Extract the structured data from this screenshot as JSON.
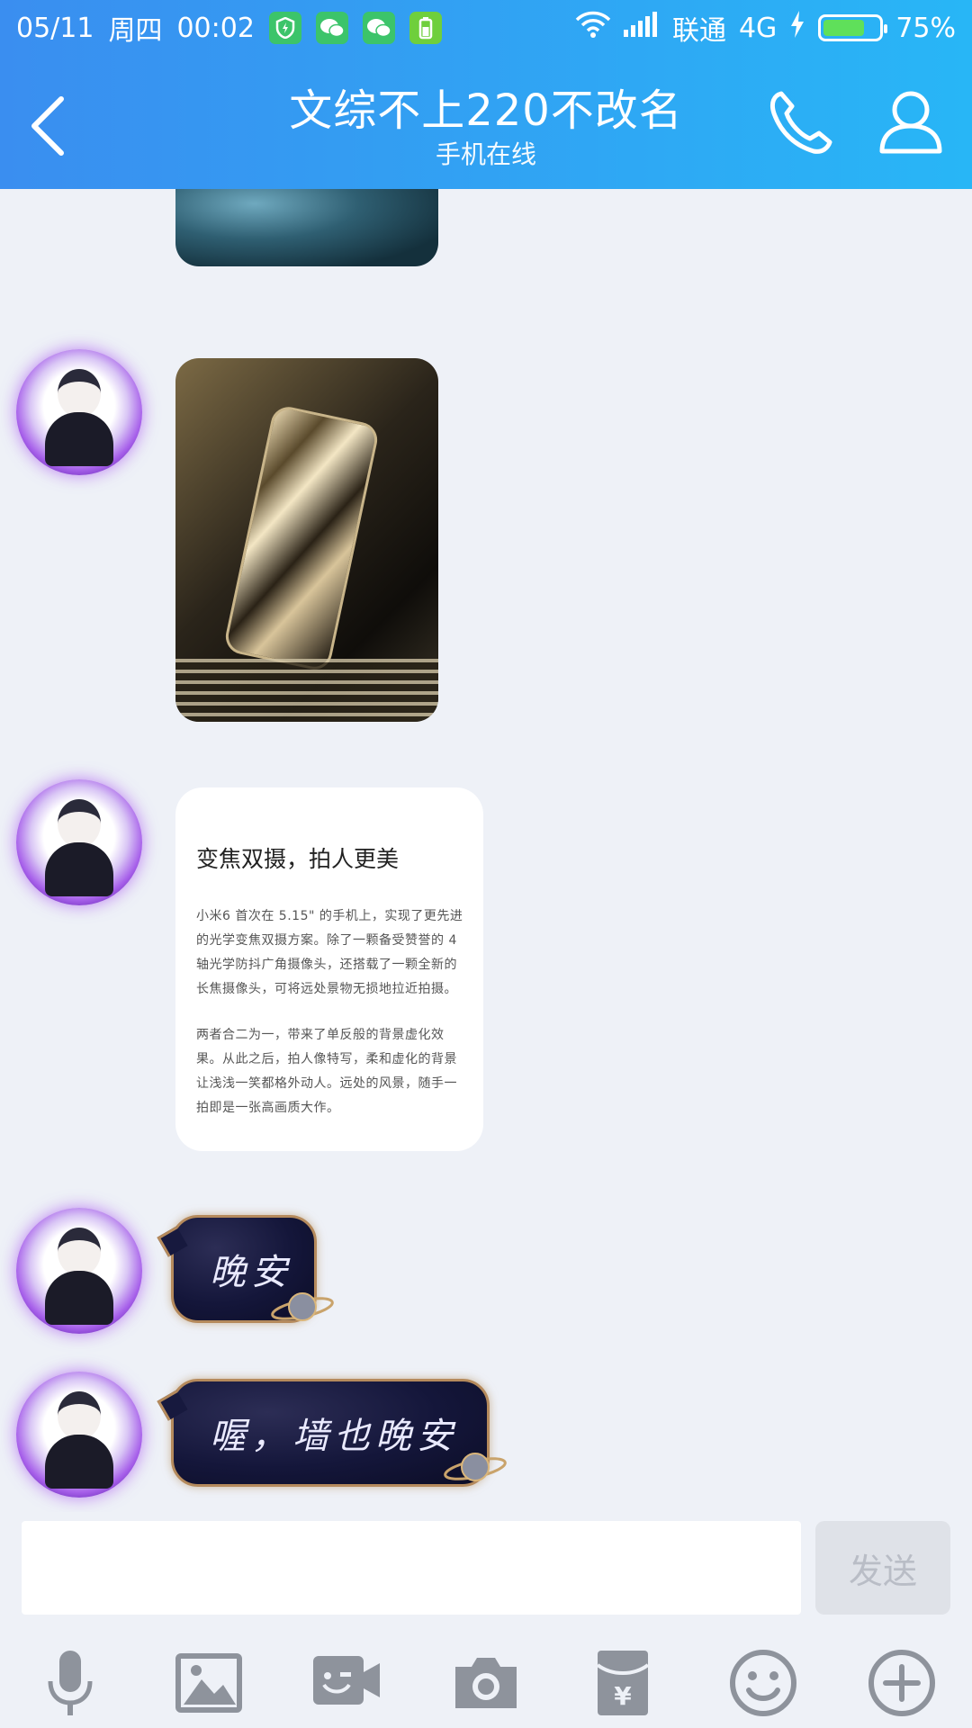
{
  "status_bar": {
    "date": "05/11",
    "weekday": "周四",
    "time": "00:02",
    "carrier": "联通",
    "network": "4G",
    "battery_percent": "75%",
    "battery_level": 0.75
  },
  "header": {
    "title": "文综不上220不改名",
    "subtitle": "手机在线",
    "colors": {
      "start": "#3a8ef0",
      "end": "#28b6f6"
    }
  },
  "messages": {
    "card": {
      "title": "变焦双摄，拍人更美",
      "para1": "小米6 首次在 5.15\" 的手机上，实现了更先进的光学变焦双摄方案。除了一颗备受赞誉的 4 轴光学防抖广角摄像头，还搭载了一颗全新的长焦摄像头，可将远处景物无损地拉近拍摄。",
      "para2": "两者合二为一，带来了单反般的背景虚化效果。从此之后，拍人像特写，柔和虚化的背景让浅浅一笑都格外动人。远处的风景，随手一拍即是一张高画质大作。"
    },
    "text1": "晚安",
    "text2": "喔，墙也晚安"
  },
  "input": {
    "placeholder": "",
    "send_label": "发送"
  },
  "icons": [
    "back-icon",
    "phone-icon",
    "profile-icon",
    "mic-icon",
    "image-icon",
    "video-chat-icon",
    "camera-icon",
    "red-packet-icon",
    "emoji-icon",
    "plus-icon"
  ]
}
